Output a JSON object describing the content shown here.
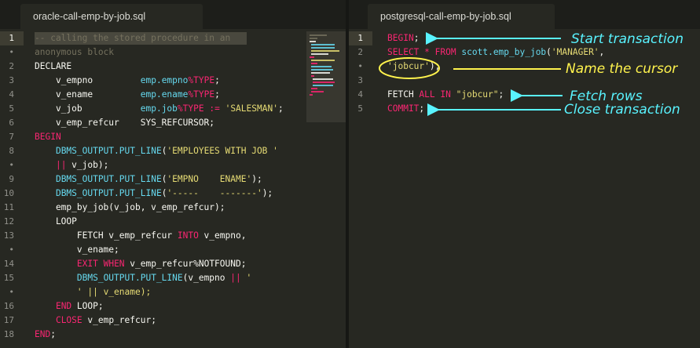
{
  "left": {
    "tab": "oracle-call-emp-by-job.sql",
    "line_numbers": [
      "1",
      "•",
      "2",
      "3",
      "4",
      "5",
      "6",
      "7",
      "8",
      "•",
      "9",
      "10",
      "11",
      "12",
      "13",
      "•",
      "14",
      "15",
      "•",
      "16",
      "17",
      "18"
    ],
    "lines": [
      "-- calling the stored procedure in an",
      "anonymous block",
      "DECLARE",
      "    v_empno         emp.empno%TYPE;",
      "    v_ename         emp.ename%TYPE;",
      "    v_job           emp.job%TYPE := 'SALESMAN';",
      "    v_emp_refcur    SYS_REFCURSOR;",
      "BEGIN",
      "    DBMS_OUTPUT.PUT_LINE('EMPLOYEES WITH JOB '",
      "    || v_job);",
      "    DBMS_OUTPUT.PUT_LINE('EMPNO    ENAME');",
      "    DBMS_OUTPUT.PUT_LINE('-----    -------');",
      "    emp_by_job(v_job, v_emp_refcur);",
      "    LOOP",
      "        FETCH v_emp_refcur INTO v_empno,",
      "        v_ename;",
      "        EXIT WHEN v_emp_refcur%NOTFOUND;",
      "        DBMS_OUTPUT.PUT_LINE(v_empno || '",
      "        ' || v_ename);",
      "    END LOOP;",
      "    CLOSE v_emp_refcur;",
      "END;"
    ]
  },
  "right": {
    "tab": "postgresql-call-emp-by-job.sql",
    "line_numbers": [
      "1",
      "2",
      "•",
      "3",
      "4",
      "5"
    ],
    "lines": [
      "BEGIN;",
      "SELECT * FROM scott.emp_by_job('MANAGER',",
      "'jobcur');",
      "",
      "FETCH ALL IN \"jobcur\";",
      "COMMIT;"
    ]
  },
  "annotations": {
    "start": "Start transaction",
    "cursor": "Name the cursor",
    "fetch": "Fetch rows",
    "close": "Close transaction"
  },
  "colors": {
    "editor_bg": "#272822",
    "keyword": "#f92672",
    "function": "#66d9ef",
    "string": "#e6db74",
    "comment": "#75715e",
    "annotation_cyan": "#59f3ff",
    "annotation_yellow": "#fff34d"
  }
}
